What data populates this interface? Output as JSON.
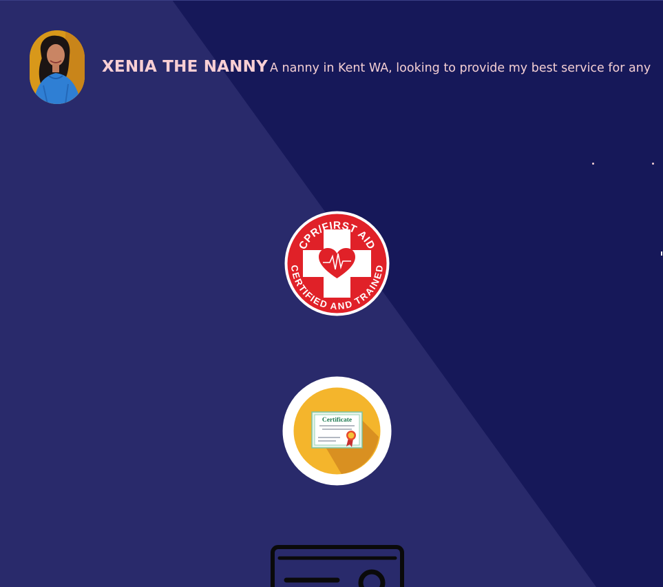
{
  "header": {
    "site_title": "XENIA THE NANNY",
    "tagline": "A nanny in Kent WA, looking to provide my best service for any"
  },
  "badges": {
    "cpr": {
      "top_text": "CPR/FIRST AID",
      "bottom_text": "CERTIFIED AND TRAINED",
      "code": "MSC1716"
    },
    "certificate": {
      "heading": "Certificate"
    }
  },
  "icons": {
    "avatar": "person-photo",
    "cpr": "cpr-first-aid-badge",
    "certificate": "certificate-badge",
    "license": "id-card-icon"
  },
  "colors": {
    "background_dark": "#161859",
    "background_light": "#292a6b",
    "title_pink": "#f9cfd4",
    "cpr_red": "#e02128",
    "cert_yellow": "#f4b52c"
  }
}
